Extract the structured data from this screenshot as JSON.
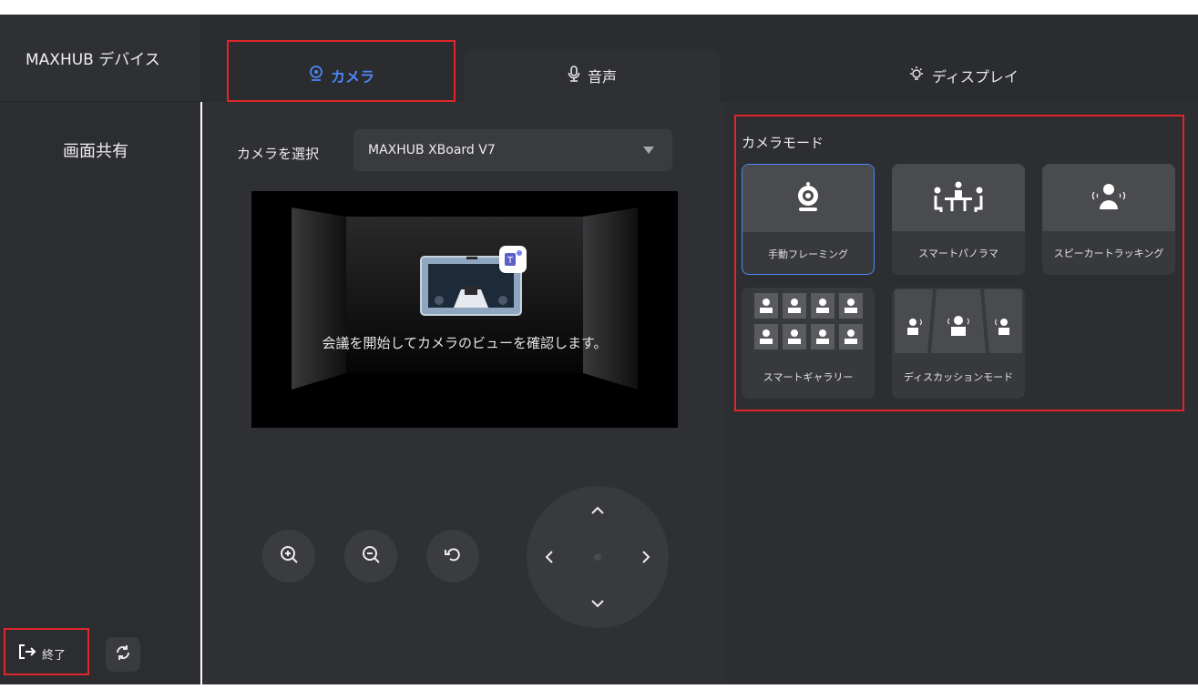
{
  "sidebar": {
    "title": "MAXHUB デバイス",
    "items": [
      {
        "label": "画面共有"
      }
    ],
    "exit_label": "終了"
  },
  "tabs": [
    {
      "label": "カメラ",
      "icon": "camera-icon",
      "active": true
    },
    {
      "label": "音声",
      "icon": "microphone-icon",
      "active": false
    },
    {
      "label": "ディスプレイ",
      "icon": "bulb-icon",
      "active": false
    }
  ],
  "camera": {
    "select_label": "カメラを選択",
    "selected_camera": "MAXHUB XBoard V7",
    "preview_message": "会議を開始してカメラのビューを確認します。"
  },
  "modes": {
    "title": "カメラモード",
    "items": [
      {
        "label": "手動フレーミング",
        "icon": "webcam-icon",
        "selected": true
      },
      {
        "label": "スマートパノラマ",
        "icon": "meeting-table-icon",
        "selected": false
      },
      {
        "label": "スピーカートラッキング",
        "icon": "speaker-tracking-icon",
        "selected": false
      },
      {
        "label": "スマートギャラリー",
        "icon": "gallery-grid-icon",
        "selected": false
      },
      {
        "label": "ディスカッションモード",
        "icon": "discussion-icon",
        "selected": false
      }
    ]
  },
  "colors": {
    "accent": "#4c86f6",
    "highlight": "#e0252c",
    "panel": "#2f3033"
  }
}
